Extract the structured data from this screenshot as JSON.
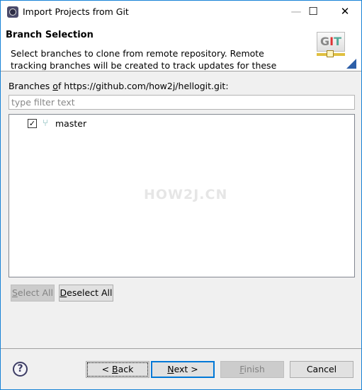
{
  "window": {
    "title": "Import Projects from Git",
    "minimize": "—",
    "maximize": "☐",
    "close": "✕"
  },
  "banner": {
    "title": "Branch Selection",
    "description": "Select branches to clone from remote repository. Remote tracking branches will be created to track updates for these branches in the",
    "logo_text": "GIT"
  },
  "branches": {
    "label_prefix": "Branches ",
    "label_mnemonic": "o",
    "label_rest": "f https://github.com/how2j/hellogit.git:",
    "filter_placeholder": "type filter text",
    "filter_value": "",
    "items": [
      {
        "name": "master",
        "checked": true,
        "check": "✓",
        "icon": "branch-icon"
      }
    ],
    "watermark": "HOW2J.CN"
  },
  "selection_buttons": {
    "select_all": {
      "mnemonic": "S",
      "rest": "elect All",
      "enabled": false
    },
    "deselect_all": {
      "mnemonic": "D",
      "rest": "eselect All",
      "enabled": true
    }
  },
  "footer": {
    "help": "?",
    "back": {
      "pre": "< ",
      "mnemonic": "B",
      "rest": "ack"
    },
    "next": {
      "mnemonic": "N",
      "rest": "ext >"
    },
    "finish": {
      "mnemonic": "F",
      "rest": "inish",
      "enabled": false
    },
    "cancel": "Cancel"
  },
  "colors": {
    "accent": "#0078d7",
    "window_border": "#1883d7"
  }
}
